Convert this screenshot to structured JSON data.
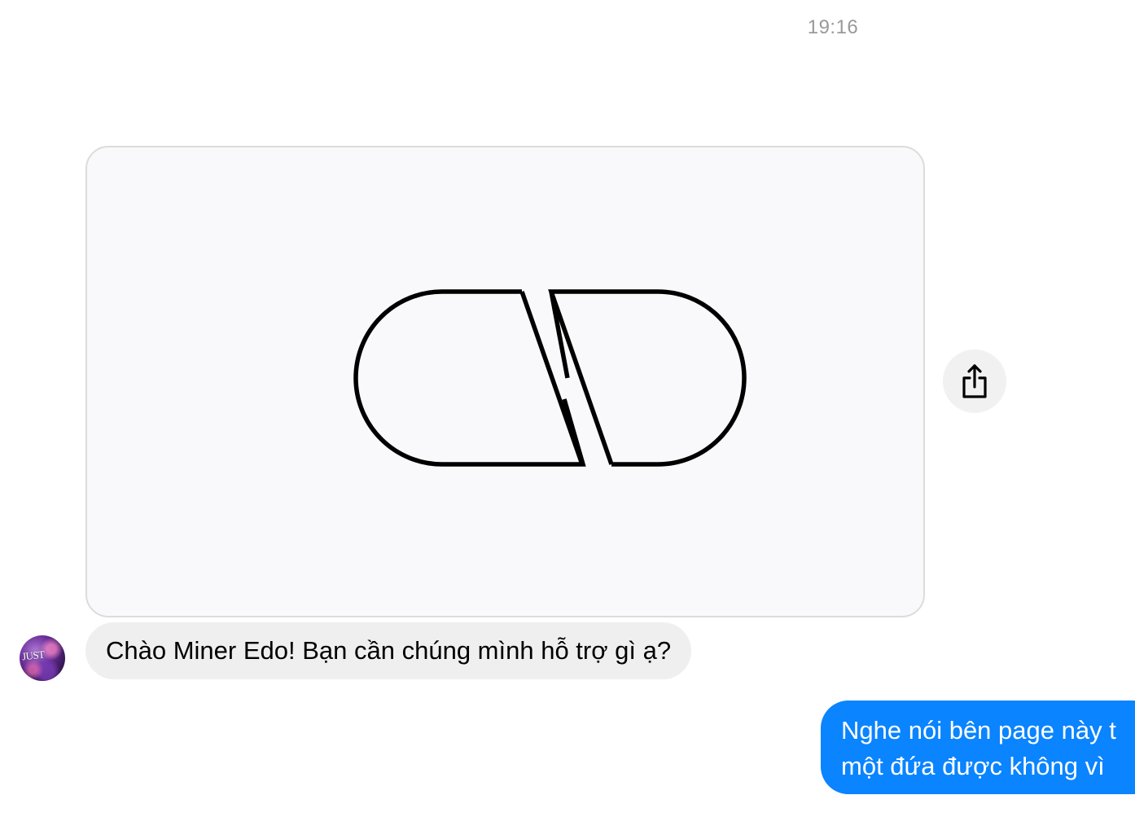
{
  "timestamp": "19:16",
  "attachment": {
    "logo_icon": "capsule-logo",
    "share_icon": "share-icon"
  },
  "incoming": {
    "avatar_text": "JUST",
    "message": "Chào Miner Edo! Bạn cần chúng mình hỗ trợ gì ạ?"
  },
  "outgoing": {
    "lines": [
      "Nghe nói bên page này t",
      "một đứa được không vì"
    ]
  },
  "colors": {
    "outgoing_bubble": "#0a84ff",
    "incoming_bubble": "#efeff0",
    "timestamp": "#9a9a9a",
    "card_background": "#f9f9fb"
  }
}
